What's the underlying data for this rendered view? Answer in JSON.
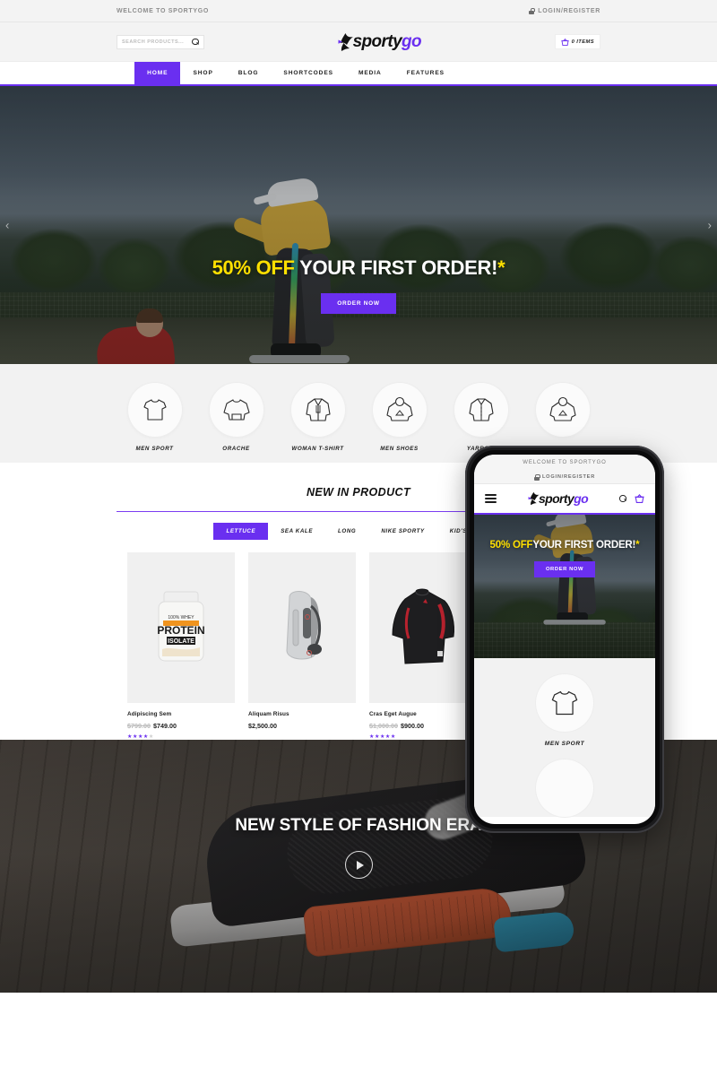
{
  "topbar": {
    "welcome": "WELCOME TO SPORTYGO",
    "login": "LOGIN/REGISTER",
    "lock_icon": "lock-icon"
  },
  "header": {
    "search_placeholder": "SEARCH PRODUCTS...",
    "search_value": "",
    "search_icon": "search-icon",
    "logo_part1": "sporty",
    "logo_part2": "go",
    "cart_label": "0 ITEMS",
    "cart_icon": "basket-icon"
  },
  "nav": {
    "items": [
      {
        "label": "HOME",
        "active": true
      },
      {
        "label": "SHOP",
        "active": false
      },
      {
        "label": "BLOG",
        "active": false
      },
      {
        "label": "SHORTCODES",
        "active": false
      },
      {
        "label": "MEDIA",
        "active": false
      },
      {
        "label": "FEATURES",
        "active": false
      }
    ]
  },
  "hero": {
    "highlight": "50% OFF",
    "title": " YOUR FIRST ORDER!",
    "asterisk": "*",
    "button": "ORDER NOW",
    "prev_icon": "chevron-left-icon",
    "next_icon": "chevron-right-icon",
    "prev_glyph": "‹",
    "next_glyph": "›"
  },
  "categories": [
    {
      "label": "MEN SPORT",
      "icon": "tshirt-icon"
    },
    {
      "label": "ORACHE",
      "icon": "sweater-icon"
    },
    {
      "label": "WOMAN T-SHIRT",
      "icon": "coat-icon"
    },
    {
      "label": "MEN SHOES",
      "icon": "hoodie-icon"
    },
    {
      "label": "YARROW",
      "icon": "shirt-icon"
    },
    {
      "label": "",
      "icon": "hoodie-icon"
    }
  ],
  "new_in_product": {
    "title": "NEW IN PRODUCT",
    "tabs": [
      {
        "label": "LETTUCE",
        "active": true
      },
      {
        "label": "SEA KALE",
        "active": false
      },
      {
        "label": "LONG",
        "active": false
      },
      {
        "label": "NIKE SPORTY",
        "active": false
      },
      {
        "label": "KID'S SPORT",
        "active": false
      }
    ],
    "products": [
      {
        "name": "Adipiscing Sem",
        "old_price": "$799.00",
        "price": "$749.00",
        "rating": 4,
        "image": "protein-tub"
      },
      {
        "name": "Aliquam Risus",
        "old_price": "",
        "price": "$2,500.00",
        "rating": 0,
        "image": "backpack"
      },
      {
        "name": "Cras Eget Augue",
        "old_price": "$1,000.00",
        "price": "$900.00",
        "rating": 5,
        "image": "compression-shirt"
      }
    ]
  },
  "phone": {
    "welcome": "WELCOME TO SPORTYGO",
    "login": "LOGIN/REGISTER",
    "logo_part1": "sporty",
    "logo_part2": "go",
    "menu_icon": "hamburger-icon",
    "search_icon": "search-icon",
    "cart_icon": "basket-icon",
    "hero_highlight": "50% OFF",
    "hero_title": "YOUR FIRST ORDER!",
    "hero_asterisk": "*",
    "hero_button": "ORDER NOW",
    "category_label": "MEN SPORT",
    "category_icon": "tshirt-icon"
  },
  "fashion": {
    "title": "NEW STYLE OF FASHION ERA",
    "play_icon": "play-icon"
  },
  "colors": {
    "accent": "#6a2ff0",
    "highlight_yellow": "#ffe000",
    "text_dark": "#1b1b1b",
    "muted": "#8d8d8d",
    "bg_light": "#f2f2f2"
  }
}
